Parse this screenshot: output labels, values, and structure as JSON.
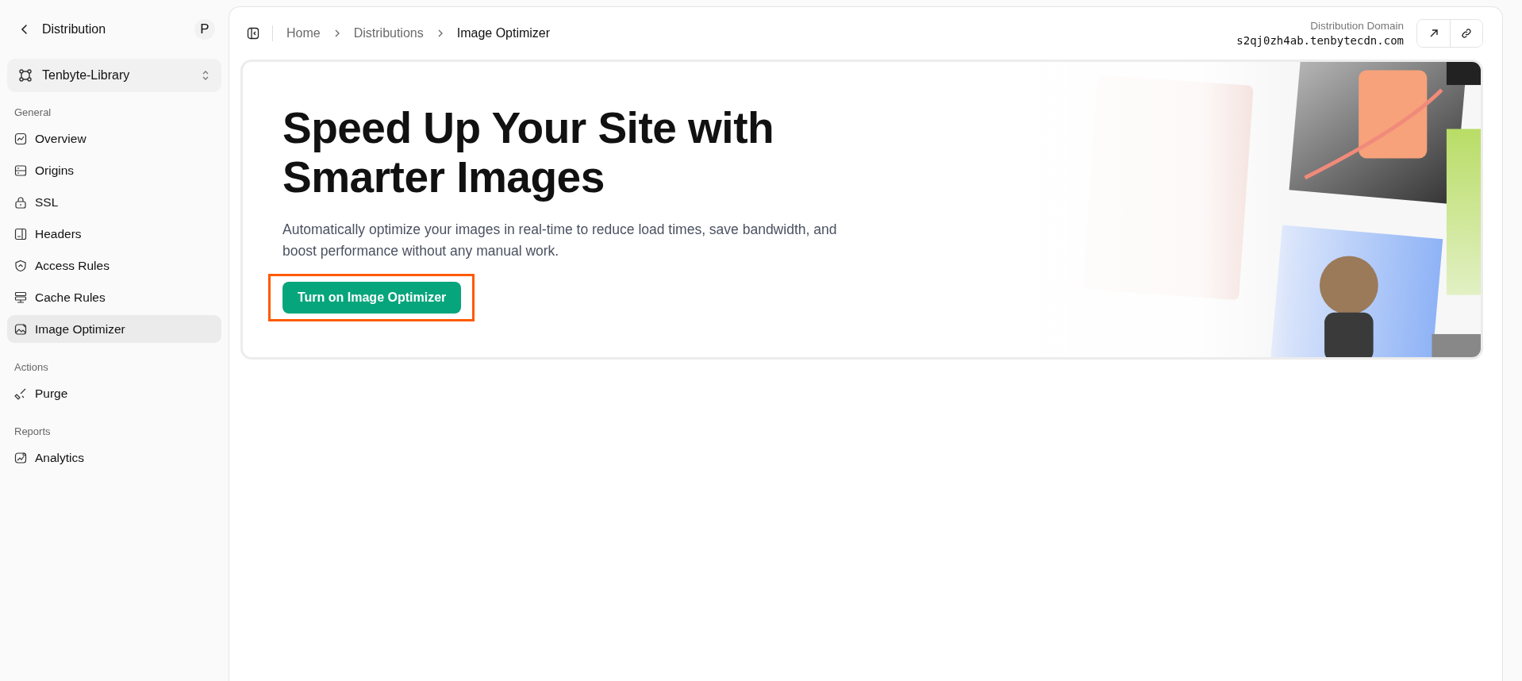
{
  "sidebar": {
    "title": "Distribution",
    "avatar": "P",
    "switcher": {
      "label": "Tenbyte-Library"
    },
    "groups": [
      {
        "label": "General",
        "items": [
          {
            "label": "Overview",
            "selected": false
          },
          {
            "label": "Origins",
            "selected": false
          },
          {
            "label": "SSL",
            "selected": false
          },
          {
            "label": "Headers",
            "selected": false
          },
          {
            "label": "Access Rules",
            "selected": false
          },
          {
            "label": "Cache Rules",
            "selected": false
          },
          {
            "label": "Image Optimizer",
            "selected": true
          }
        ]
      },
      {
        "label": "Actions",
        "items": [
          {
            "label": "Purge",
            "selected": false
          }
        ]
      },
      {
        "label": "Reports",
        "items": [
          {
            "label": "Analytics",
            "selected": false
          }
        ]
      }
    ]
  },
  "breadcrumbs": [
    "Home",
    "Distributions",
    "Image Optimizer"
  ],
  "domain": {
    "label": "Distribution Domain",
    "value": "s2qj0zh4ab.tenbytecdn.com"
  },
  "hero": {
    "title": "Speed Up Your Site with Smarter Images",
    "description": "Automatically optimize your images in real-time to reduce load times, save bandwidth, and boost performance without any manual work.",
    "button": "Turn on Image Optimizer",
    "highlighted": true
  }
}
